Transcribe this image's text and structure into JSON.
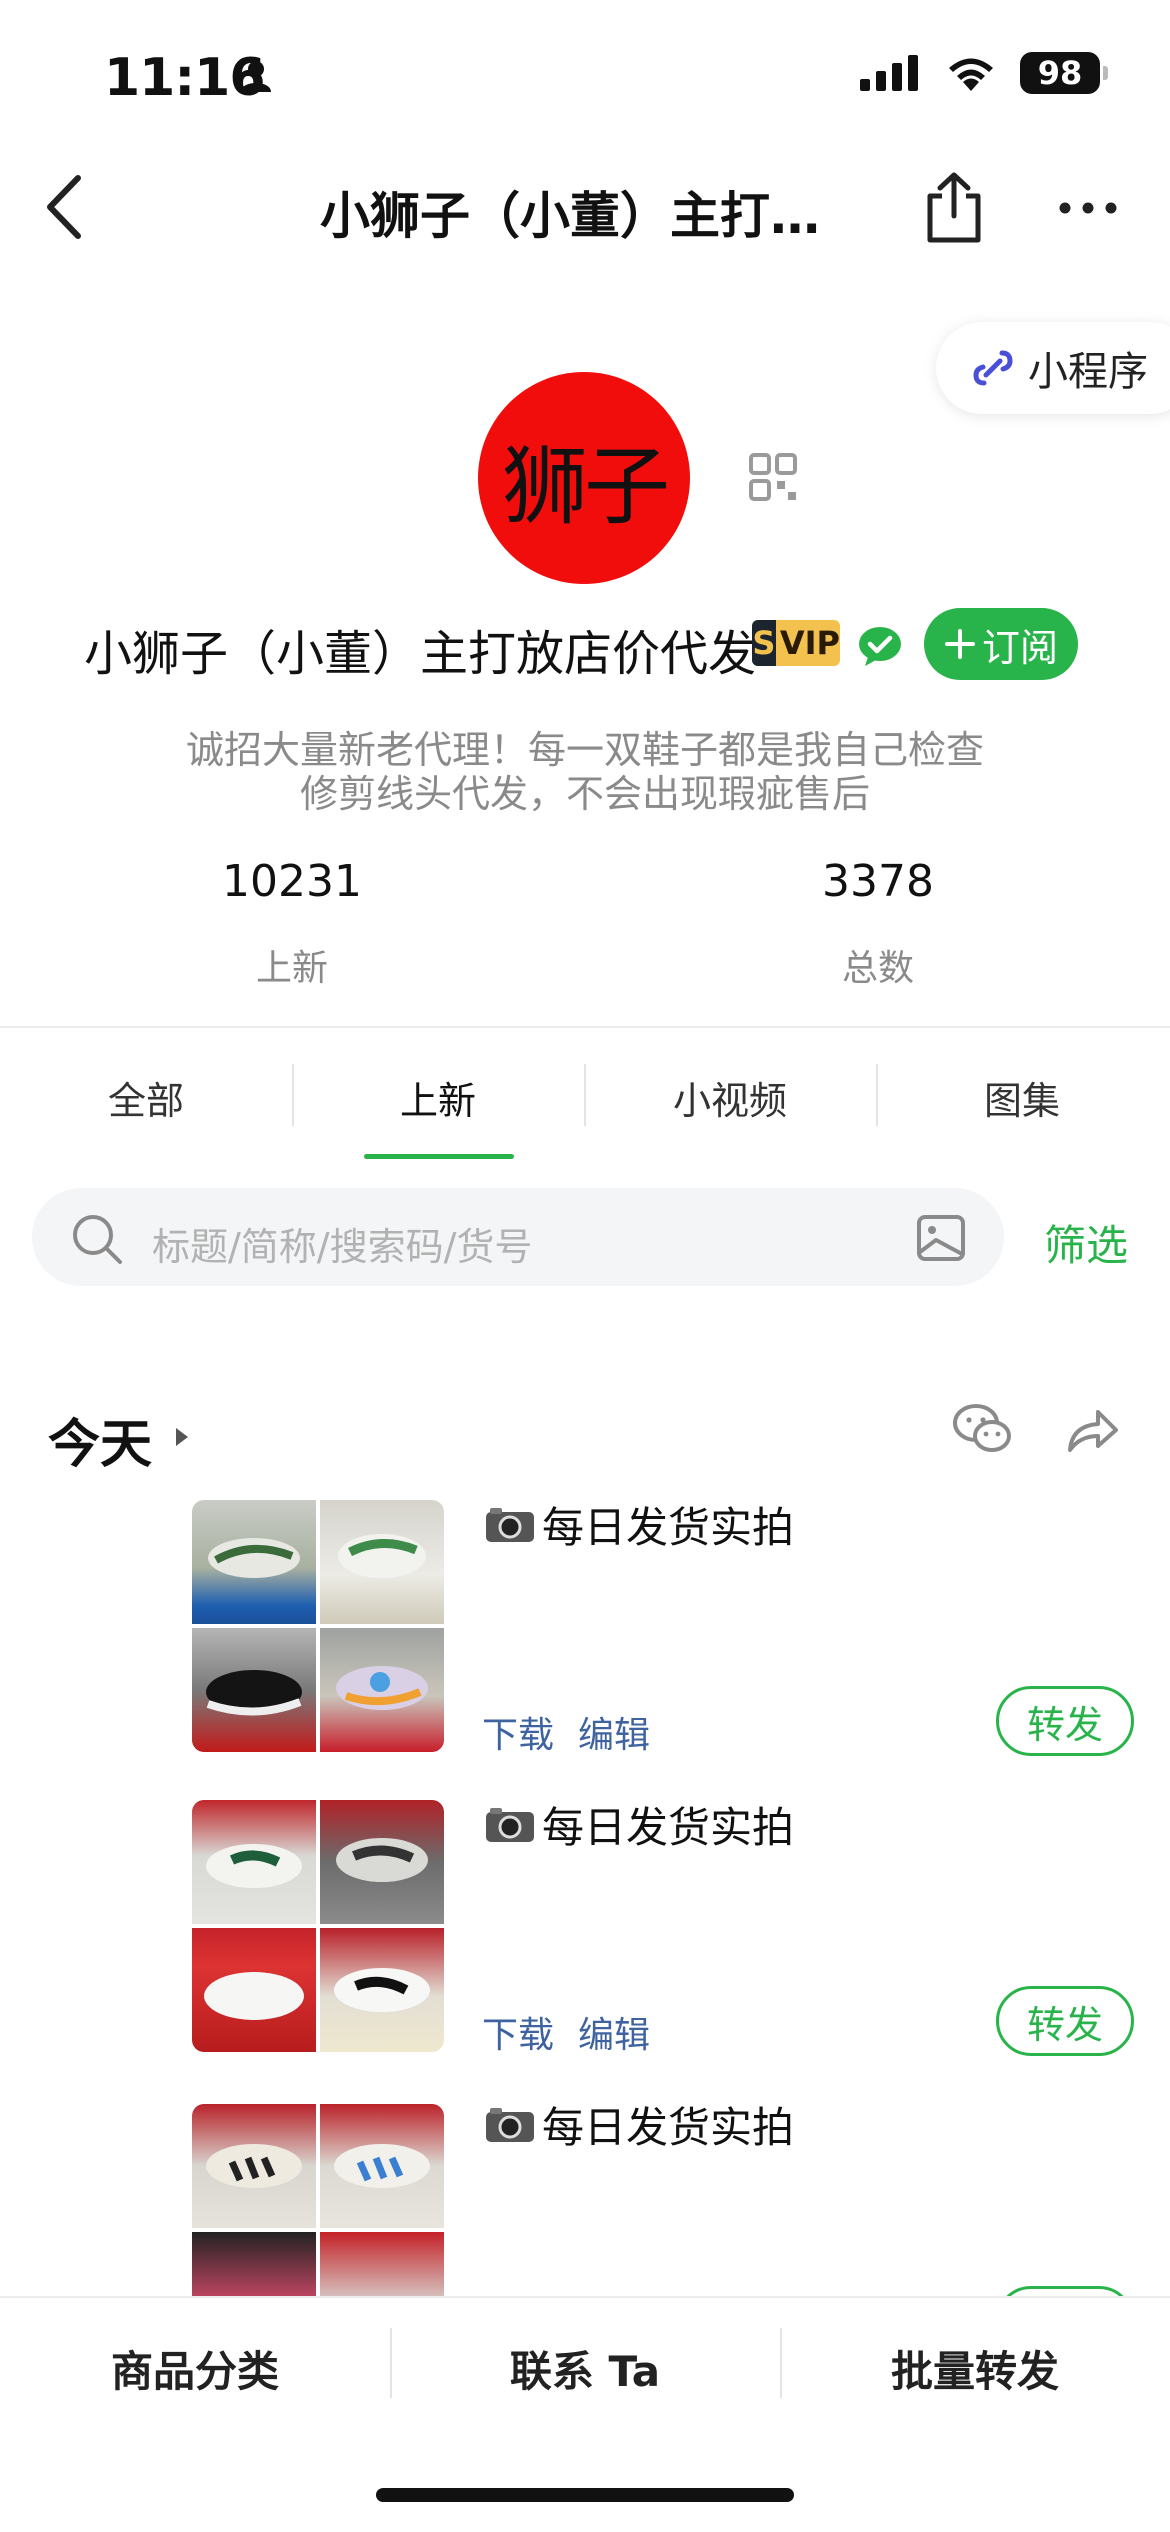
{
  "status_bar": {
    "time": "11:16",
    "battery": "98"
  },
  "nav": {
    "title": "小狮子（小董）主打…"
  },
  "mini_program": {
    "label": "小程序"
  },
  "profile": {
    "avatar_text": "狮子",
    "name": "小狮子（小董）主打放店价代发",
    "vip_s": "S",
    "vip_label": "VIP",
    "subscribe_label": "订阅",
    "description_line1": "诚招大量新老代理！每一双鞋子都是我自己检查",
    "description_line2": "修剪线头代发，不会出现瑕疵售后",
    "stats": [
      {
        "value": "10231",
        "label": "上新"
      },
      {
        "value": "3378",
        "label": "总数"
      }
    ]
  },
  "tabs": [
    {
      "label": "全部"
    },
    {
      "label": "上新"
    },
    {
      "label": "小视频"
    },
    {
      "label": "图集"
    }
  ],
  "active_tab": "上新",
  "search": {
    "placeholder": "标题/简称/搜索码/货号",
    "filter_label": "筛选"
  },
  "section": {
    "title": "今天"
  },
  "posts": [
    {
      "title": "每日发货实拍",
      "download": "下载",
      "edit": "编辑",
      "reshare": "转发"
    },
    {
      "title": "每日发货实拍",
      "download": "下载",
      "edit": "编辑",
      "reshare": "转发"
    },
    {
      "title": "每日发货实拍"
    }
  ],
  "bottom_bar": [
    {
      "label": "商品分类"
    },
    {
      "label": "联系 Ta"
    },
    {
      "label": "批量转发"
    }
  ],
  "colors": {
    "accent": "#28b44a",
    "link": "#3f63a0",
    "avatar_bg": "#f20d0d"
  }
}
